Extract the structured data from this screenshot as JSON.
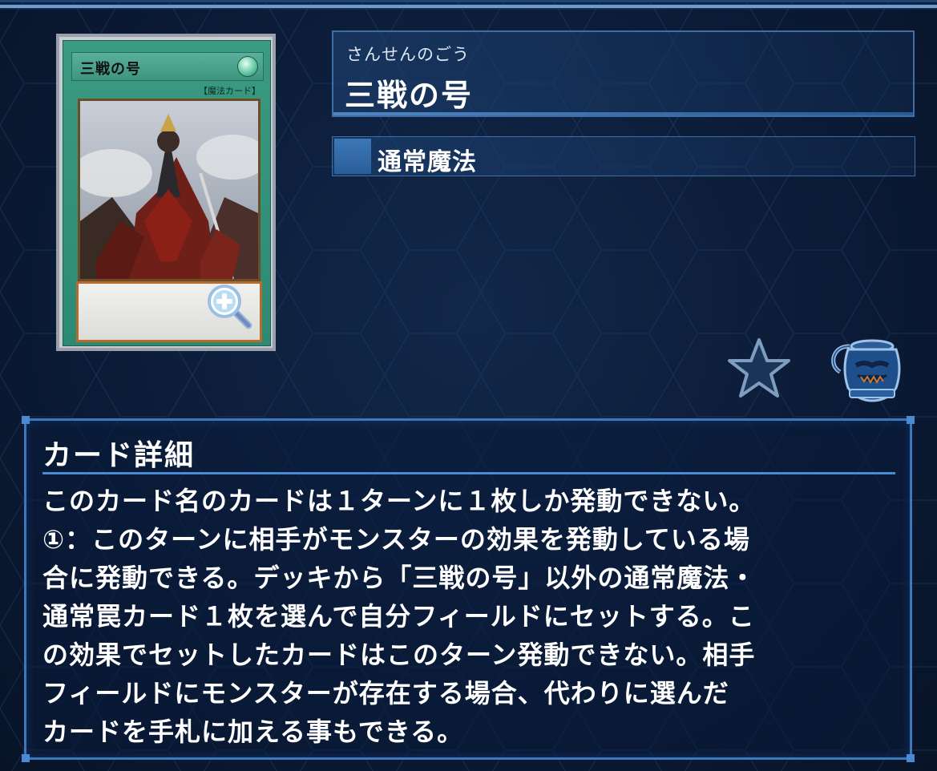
{
  "card": {
    "image_name": "三戦の号",
    "image_type_line": "【魔法カード】",
    "reading": "さんせんのごう",
    "name": "三戦の号",
    "type": "通常魔法"
  },
  "icons": {
    "zoom": "zoom-in-icon",
    "favorite": "star-icon",
    "pot": "pot-of-greed-icon"
  },
  "details": {
    "title": "カード詳細",
    "text": "このカード名のカードは１ターンに１枚しか発動できない。\n①：このターンに相手がモンスターの効果を発動している場\n合に発動できる。デッキから「三戦の号」以外の通常魔法・\n通常罠カード１枚を選んで自分フィールドにセットする。こ\nの効果でセットしたカードはこのターン発動できない。相手\nフィールドにモンスターが存在する場合、代わりに選んだ\nカードを手札に加える事もできる。"
  },
  "colors": {
    "background": "#0c1a33",
    "accent": "#3d78bf",
    "card_frame": "#2c8a72"
  }
}
